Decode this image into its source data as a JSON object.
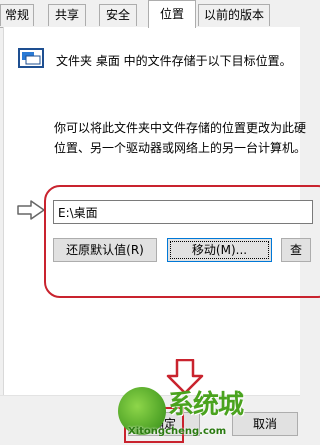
{
  "tabs": [
    {
      "label": "常规"
    },
    {
      "label": "共享"
    },
    {
      "label": "安全"
    },
    {
      "label": "位置"
    },
    {
      "label": "以前的版本"
    }
  ],
  "active_tab": "位置",
  "icons": {
    "folder": "folder-location-icon",
    "hollow_arrow": "hollow-right-arrow-icon",
    "down_arrow": "hollow-down-arrow-icon"
  },
  "panel": {
    "description_line1": "文件夹 桌面 中的文件存储于以下目标位置。",
    "description_line2": "你可以将此文件夹中文件存储的位置更改为此硬",
    "description_line3": "位置、另一个驱动器或网络上的另一台计算机。"
  },
  "location_path": "E:\\桌面",
  "buttons": {
    "restore_default": "还原默认值(R)",
    "move": "移动(M)...",
    "find_target": "查"
  },
  "footer": {
    "ok": "确定",
    "cancel": "取消"
  },
  "watermark": {
    "brand": "系统城",
    "site": "Xitongcheng.com"
  },
  "colors": {
    "annotation_red": "#c9232e",
    "focus_blue": "#0078d7"
  }
}
